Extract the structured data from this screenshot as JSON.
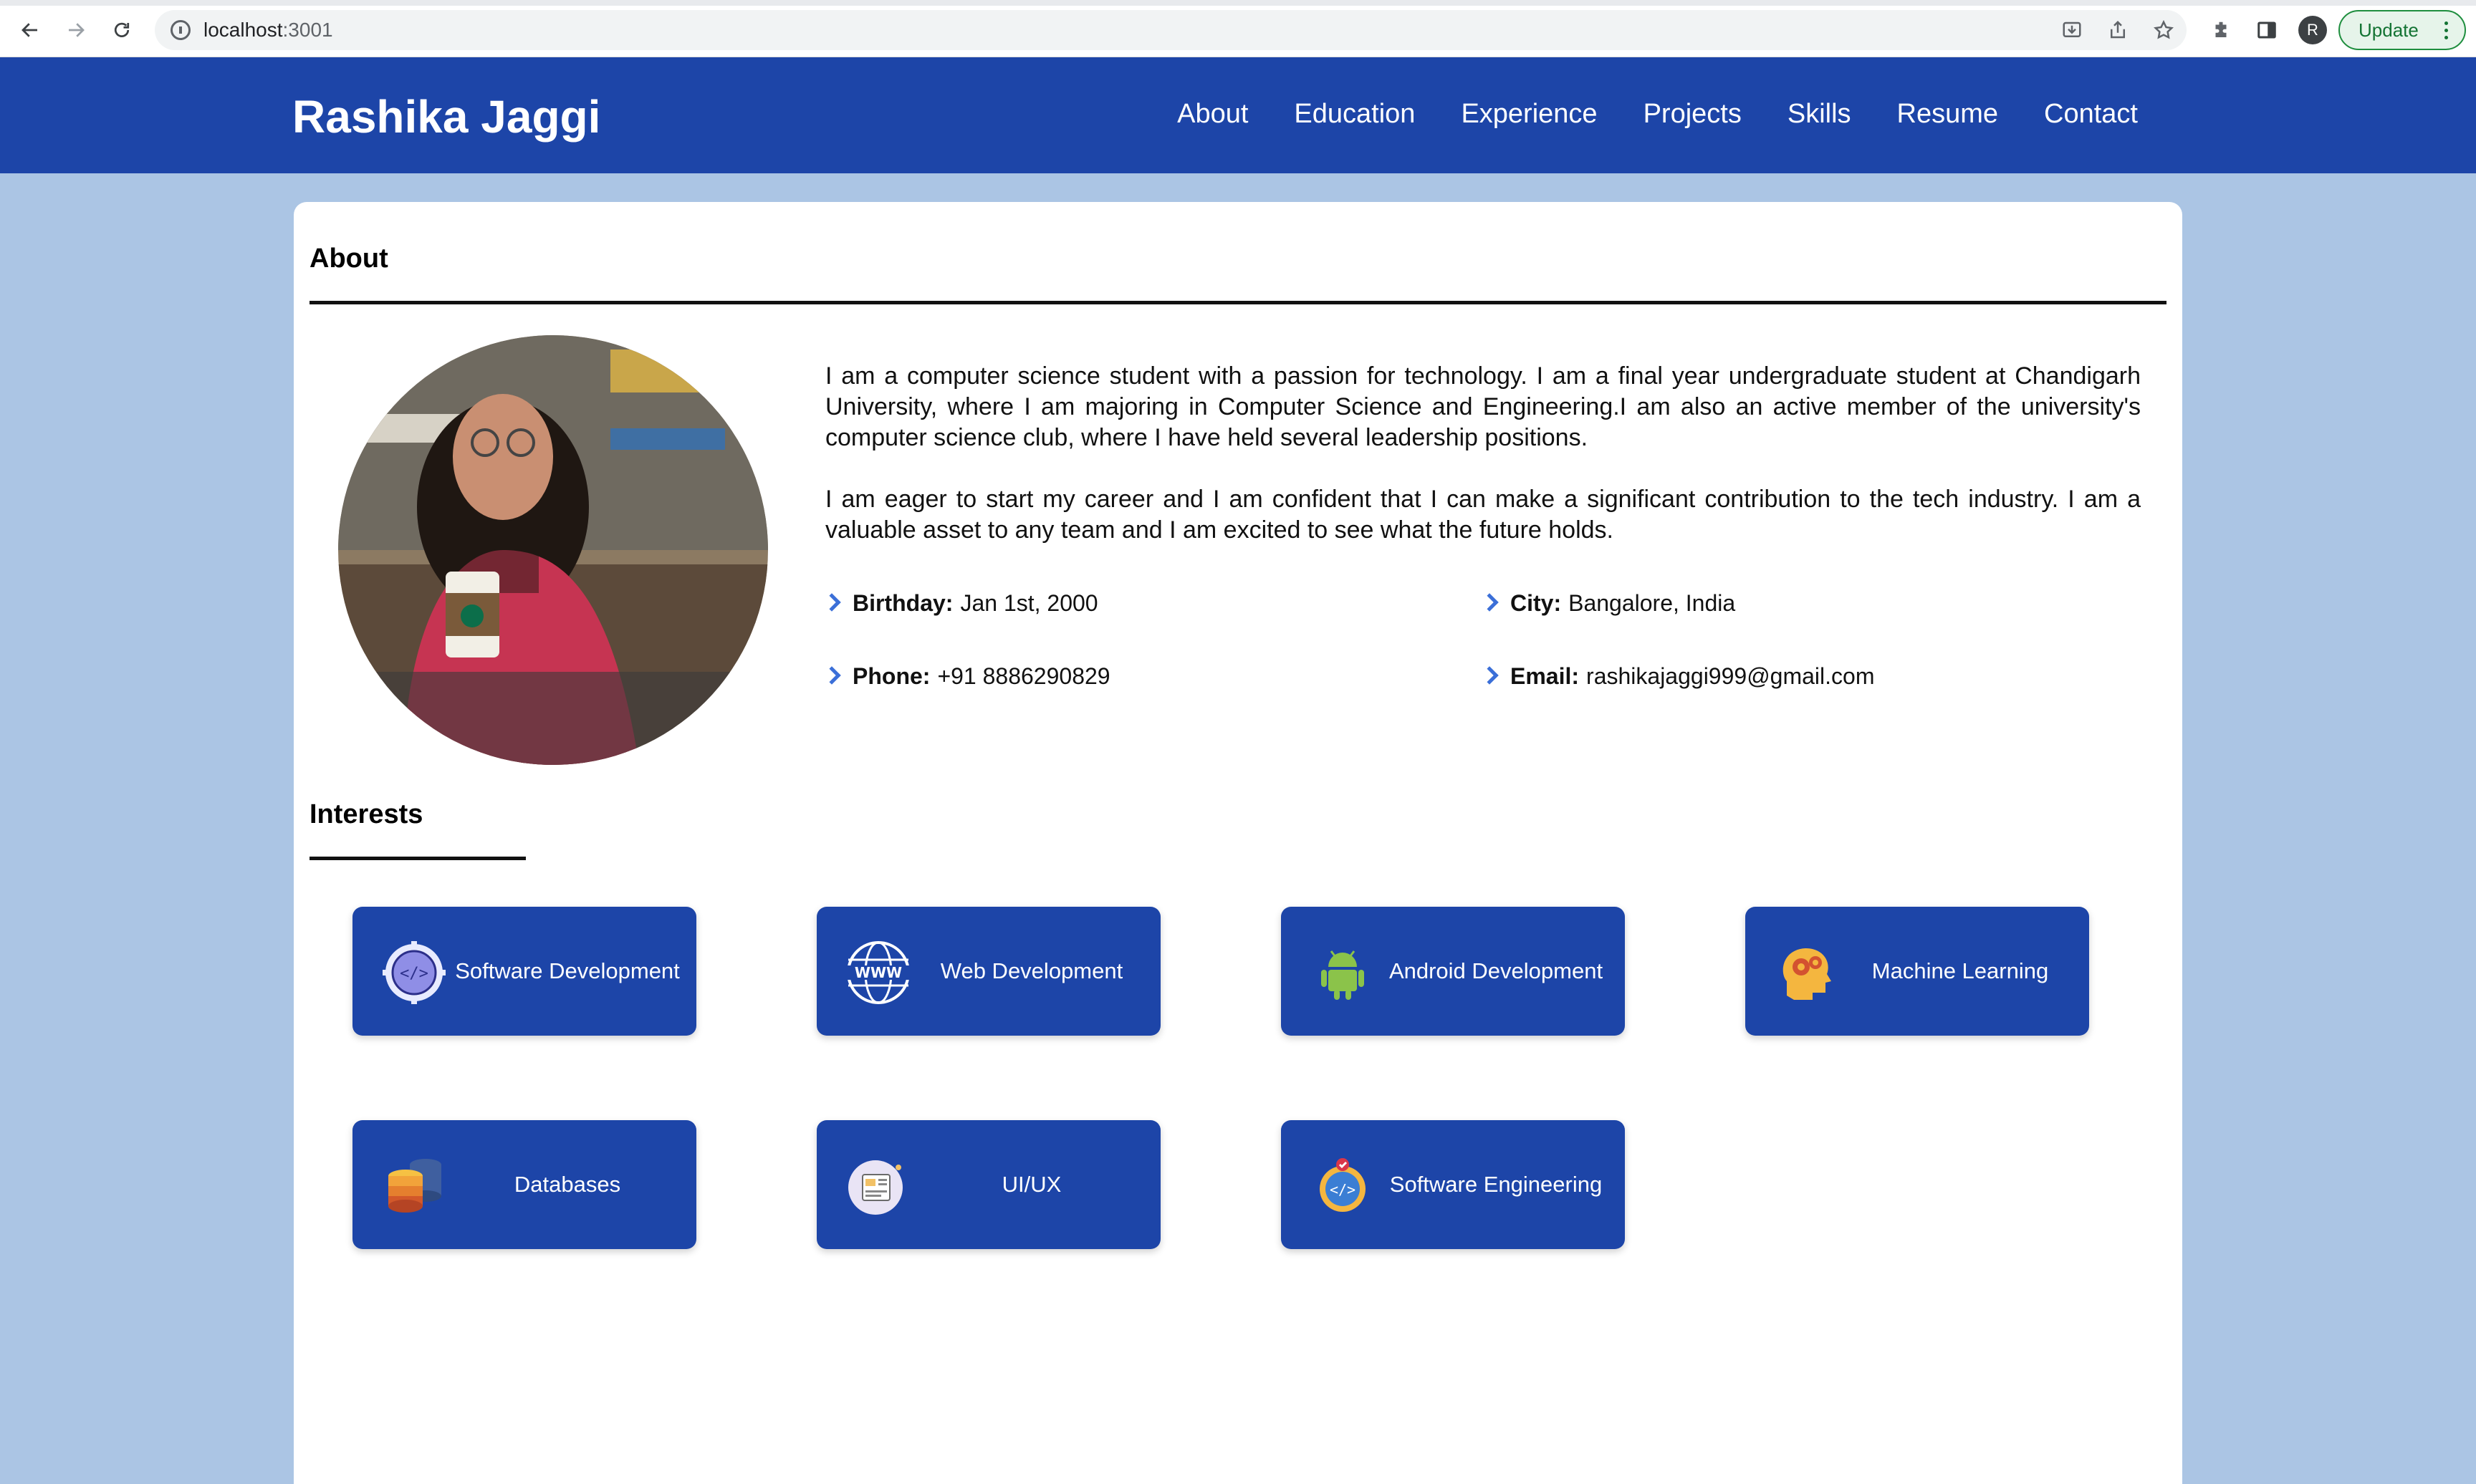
{
  "browser": {
    "url_host": "localhost",
    "url_port": ":3001",
    "profile_initial": "R",
    "update_label": "Update"
  },
  "header": {
    "brand": "Rashika Jaggi",
    "nav": [
      "About",
      "Education",
      "Experience",
      "Projects",
      "Skills",
      "Resume",
      "Contact"
    ]
  },
  "about": {
    "title": "About",
    "paragraphs": [
      "I am a computer science student with a passion for technology. I am a final year undergraduate student at Chandigarh University, where I am majoring in Computer Science and Engineering.I am also an active member of the university's computer science club, where I have held several leadership positions.",
      "I am eager to start my career and I am confident that I can make a significant contribution to the tech industry. I am a valuable asset to any team and I am excited to see what the future holds."
    ],
    "details": {
      "birthday": {
        "label": "Birthday:",
        "value": "Jan 1st, 2000"
      },
      "city": {
        "label": "City:",
        "value": "Bangalore, India"
      },
      "phone": {
        "label": "Phone:",
        "value": "+91 8886290829"
      },
      "email": {
        "label": "Email:",
        "value": "rashikajaggi999@gmail.com"
      }
    }
  },
  "interests": {
    "title": "Interests",
    "items": [
      {
        "label": "Software Development",
        "icon": "gear-code-icon"
      },
      {
        "label": "Web Development",
        "icon": "globe-www-icon"
      },
      {
        "label": "Android Development",
        "icon": "android-icon"
      },
      {
        "label": "Machine Learning",
        "icon": "head-gears-icon"
      },
      {
        "label": "Databases",
        "icon": "database-icon"
      },
      {
        "label": "UI/UX",
        "icon": "ui-window-icon"
      },
      {
        "label": "Software Engineering",
        "icon": "code-badge-icon"
      }
    ]
  },
  "colors": {
    "header_blue": "#1d45a8",
    "page_bg": "#abc5e4",
    "chevron_blue": "#3b6fd8"
  }
}
